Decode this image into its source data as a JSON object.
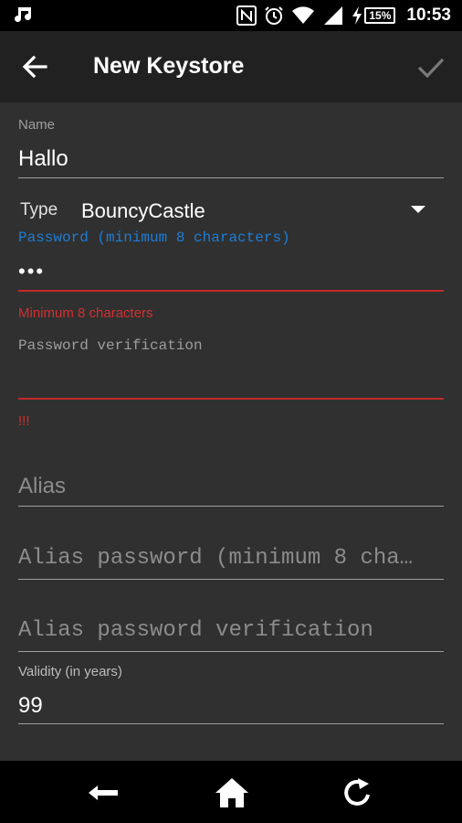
{
  "status_bar": {
    "time": "10:53",
    "battery": "15%",
    "icons": [
      "music-note-icon",
      "nfc-icon",
      "alarm-icon",
      "wifi-icon",
      "signal-icon",
      "charging-icon"
    ]
  },
  "toolbar": {
    "title": "New Keystore",
    "back_icon": "arrow-back-icon",
    "confirm_icon": "check-icon"
  },
  "form": {
    "name": {
      "label": "Name",
      "value": "Hallo"
    },
    "type": {
      "label": "Type",
      "value": "BouncyCastle"
    },
    "password": {
      "label": "Password (minimum 8 characters)",
      "value": "•••",
      "error": "Minimum 8 characters"
    },
    "password_verification": {
      "label": "Password verification",
      "value": "",
      "error": "!!!"
    },
    "alias": {
      "placeholder": "Alias"
    },
    "alias_password": {
      "placeholder": "Alias password (minimum 8 cha…"
    },
    "alias_password_verification": {
      "placeholder": "Alias password verification"
    },
    "validity": {
      "label": "Validity (in years)",
      "value": "99"
    }
  },
  "nav_bar": {
    "icons": [
      "back-arrow-icon",
      "home-icon",
      "recent-apps-icon"
    ]
  },
  "colors": {
    "background": "#303030",
    "toolbar": "#212121",
    "accent_blue": "#1e7dd6",
    "error_red": "#c62828"
  }
}
